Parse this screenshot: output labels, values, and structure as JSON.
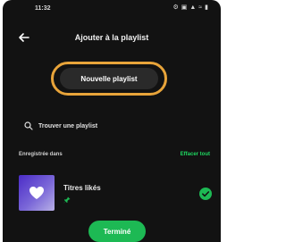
{
  "status_bar": {
    "time": "11:32",
    "icons": [
      "settings-icon",
      "message-icon",
      "signal-icon",
      "wifi-icon",
      "battery-icon"
    ]
  },
  "header": {
    "title": "Ajouter à la playlist",
    "back_icon": "arrow-left-icon"
  },
  "new_playlist": {
    "label": "Nouvelle playlist",
    "highlight_color": "#e8a43a"
  },
  "search": {
    "label": "Trouver une playlist",
    "icon": "search-icon"
  },
  "saved_section": {
    "title": "Enregistrée dans",
    "clear_label": "Effacer tout"
  },
  "playlists": [
    {
      "title": "Titres likés",
      "cover_icon": "heart-icon",
      "pinned": true,
      "selected": true
    }
  ],
  "done_button": {
    "label": "Terminé"
  },
  "colors": {
    "background": "#121212",
    "accent": "#1db954",
    "button_bg": "#2a2a2a"
  }
}
